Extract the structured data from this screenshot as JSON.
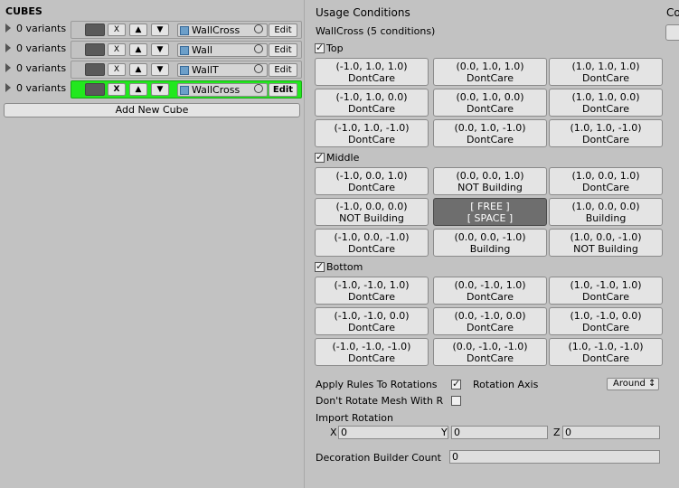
{
  "left": {
    "title": "CUBES",
    "rows": [
      {
        "variants": "0 variants",
        "x": "X",
        "up": "▲",
        "down": "▼",
        "object": "WallCross",
        "edit": "Edit"
      },
      {
        "variants": "0 variants",
        "x": "X",
        "up": "▲",
        "down": "▼",
        "object": "Wall",
        "edit": "Edit"
      },
      {
        "variants": "0 variants",
        "x": "X",
        "up": "▲",
        "down": "▼",
        "object": "WallT",
        "edit": "Edit"
      },
      {
        "variants": "0 variants",
        "x": "X",
        "up": "▲",
        "down": "▼",
        "object": "WallCross",
        "edit": "Edit"
      }
    ],
    "selected_row": 3,
    "add_button": "Add New Cube"
  },
  "right": {
    "title": "Usage Conditions",
    "title2": "Co",
    "subtitle": "WallCross (5 conditions)",
    "sections": [
      {
        "label": "Top",
        "checked": true,
        "cells": [
          {
            "coord": "(-1.0, 1.0, 1.0)",
            "state": "DontCare"
          },
          {
            "coord": "(0.0, 1.0, 1.0)",
            "state": "DontCare"
          },
          {
            "coord": "(1.0, 1.0, 1.0)",
            "state": "DontCare"
          },
          {
            "coord": "(-1.0, 1.0, 0.0)",
            "state": "DontCare"
          },
          {
            "coord": "(0.0, 1.0, 0.0)",
            "state": "DontCare"
          },
          {
            "coord": "(1.0, 1.0, 0.0)",
            "state": "DontCare"
          },
          {
            "coord": "(-1.0, 1.0, -1.0)",
            "state": "DontCare"
          },
          {
            "coord": "(0.0, 1.0, -1.0)",
            "state": "DontCare"
          },
          {
            "coord": "(1.0, 1.0, -1.0)",
            "state": "DontCare"
          }
        ]
      },
      {
        "label": "Middle",
        "checked": true,
        "cells": [
          {
            "coord": "(-1.0, 0.0, 1.0)",
            "state": "DontCare"
          },
          {
            "coord": "(0.0, 0.0, 1.0)",
            "state": "NOT Building"
          },
          {
            "coord": "(1.0, 0.0, 1.0)",
            "state": "DontCare"
          },
          {
            "coord": "(-1.0, 0.0, 0.0)",
            "state": "NOT Building"
          },
          {
            "coord": "[ FREE ]",
            "state": "[ SPACE ]"
          },
          {
            "coord": "(1.0, 0.0, 0.0)",
            "state": "Building"
          },
          {
            "coord": "(-1.0, 0.0, -1.0)",
            "state": "DontCare"
          },
          {
            "coord": "(0.0, 0.0, -1.0)",
            "state": "Building"
          },
          {
            "coord": "(1.0, 0.0, -1.0)",
            "state": "NOT Building"
          }
        ]
      },
      {
        "label": "Bottom",
        "checked": true,
        "cells": [
          {
            "coord": "(-1.0, -1.0, 1.0)",
            "state": "DontCare"
          },
          {
            "coord": "(0.0, -1.0, 1.0)",
            "state": "DontCare"
          },
          {
            "coord": "(1.0, -1.0, 1.0)",
            "state": "DontCare"
          },
          {
            "coord": "(-1.0, -1.0, 0.0)",
            "state": "DontCare"
          },
          {
            "coord": "(0.0, -1.0, 0.0)",
            "state": "DontCare"
          },
          {
            "coord": "(1.0, -1.0, 0.0)",
            "state": "DontCare"
          },
          {
            "coord": "(-1.0, -1.0, -1.0)",
            "state": "DontCare"
          },
          {
            "coord": "(0.0, -1.0, -1.0)",
            "state": "DontCare"
          },
          {
            "coord": "(1.0, -1.0, -1.0)",
            "state": "DontCare"
          }
        ]
      }
    ],
    "apply_rules_label": "Apply Rules To Rotations",
    "apply_rules_checked": true,
    "rotation_axis_label": "Rotation Axis",
    "rotation_axis_value": "Around ↕",
    "dont_rotate_label": "Don't Rotate Mesh With R",
    "dont_rotate_checked": false,
    "import_rotation_label": "Import Rotation",
    "import_rotation": {
      "x_label": "X",
      "x": "0",
      "y_label": "Y",
      "y": "0",
      "z_label": "Z",
      "z": "0"
    },
    "deco_label": "Decoration Builder Count",
    "deco_value": "0"
  },
  "colors": {
    "selected_row": "#22e81e",
    "panel": "#c2c2c2",
    "button": "#e4e4e4",
    "free_cell": "#6e6e6e"
  }
}
